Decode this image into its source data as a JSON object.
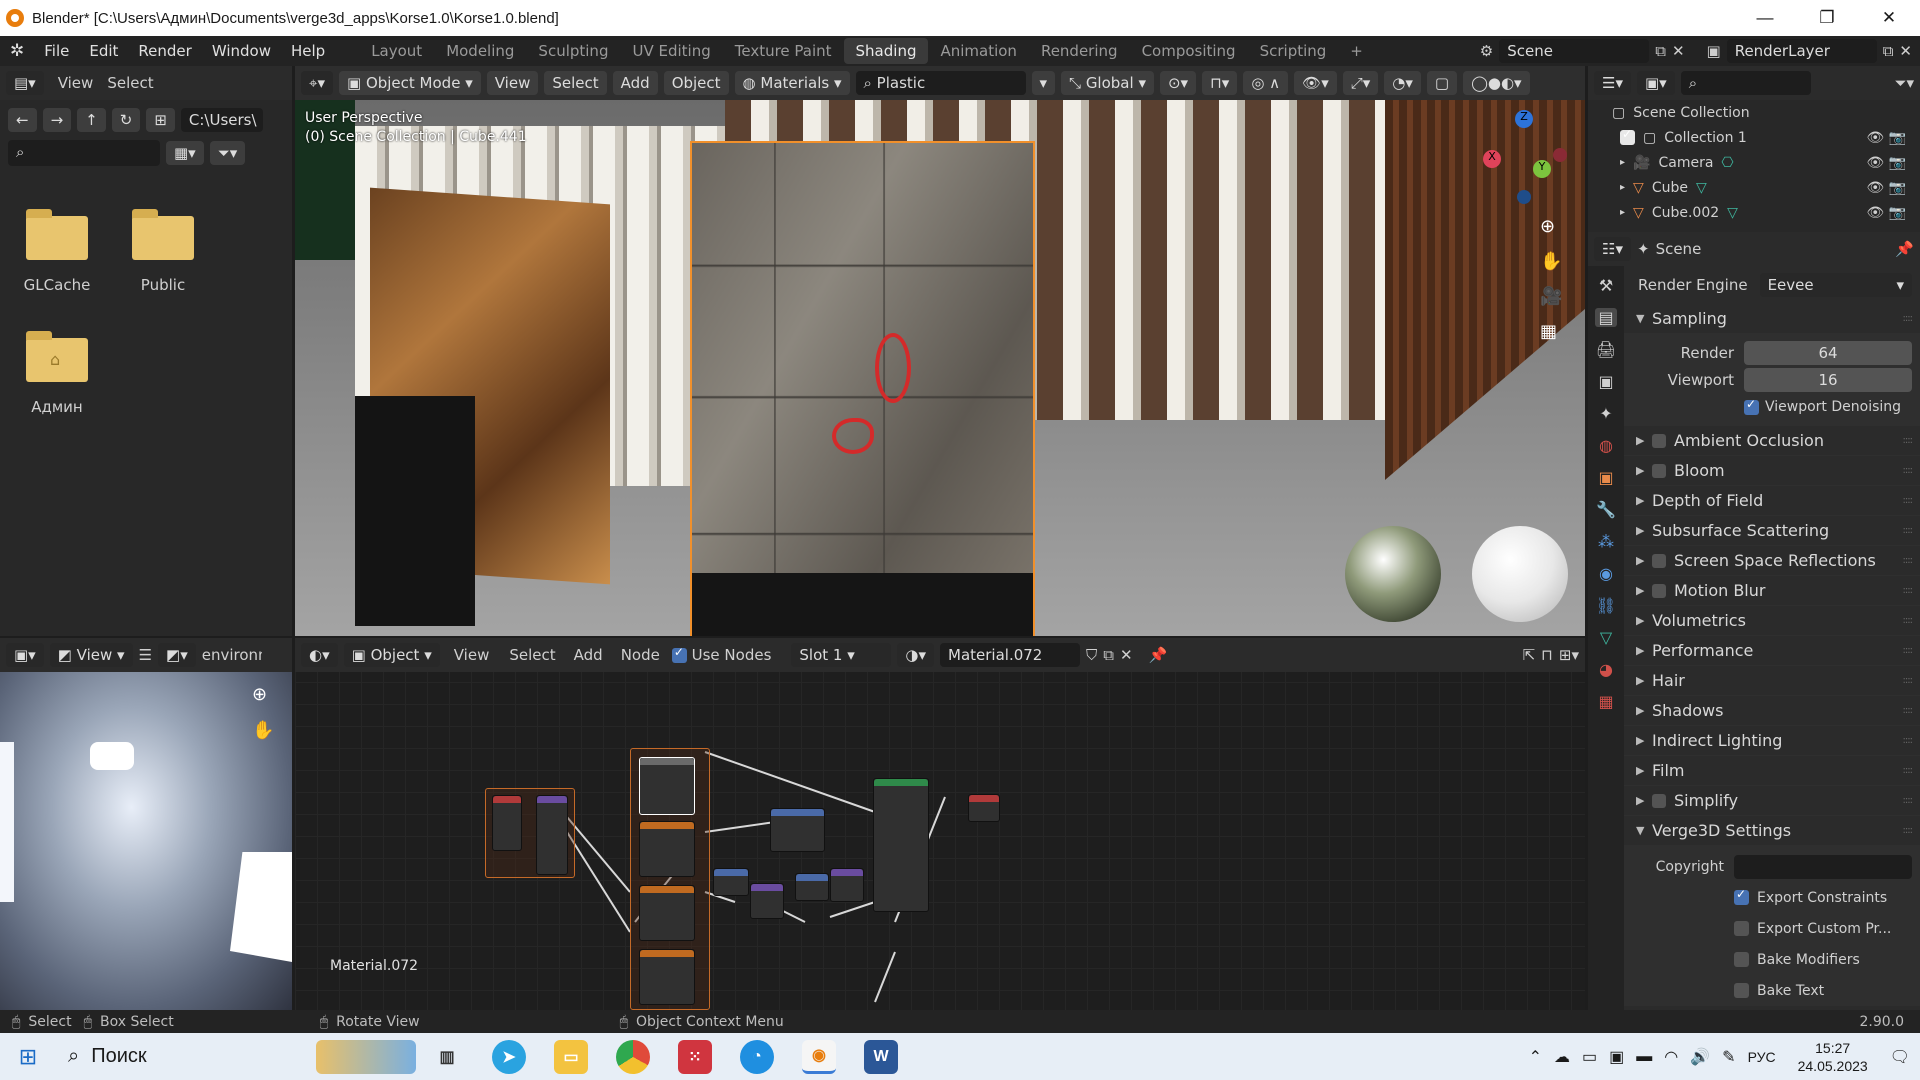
{
  "window": {
    "title": "Blender* [C:\\Users\\Админ\\Documents\\verge3d_apps\\Korse1.0\\Korse1.0.blend]",
    "minimize": "—",
    "maximize": "❐",
    "close": "✕"
  },
  "menu": [
    "File",
    "Edit",
    "Render",
    "Window",
    "Help"
  ],
  "workspaces": [
    "Layout",
    "Modeling",
    "Sculpting",
    "UV Editing",
    "Texture Paint",
    "Shading",
    "Animation",
    "Rendering",
    "Compositing",
    "Scripting"
  ],
  "active_workspace": "Shading",
  "scene": {
    "name": "Scene",
    "layer": "RenderLayer"
  },
  "filebrowser": {
    "menu": [
      "View",
      "Select"
    ],
    "path": "C:\\Users\\",
    "items": [
      {
        "name": "GLCache",
        "type": "folder"
      },
      {
        "name": "Public",
        "type": "folder"
      },
      {
        "name": "Админ",
        "type": "home-folder"
      }
    ]
  },
  "viewport": {
    "mode": "Object Mode",
    "menu": [
      "View",
      "Select",
      "Add",
      "Object"
    ],
    "materials_label": "Materials",
    "search_value": "Plastic",
    "orientation": "Global",
    "overlay_line1": "User Perspective",
    "overlay_line2": "(0) Scene Collection | Cube.441",
    "gizmo": {
      "x": "X",
      "y": "Y",
      "z": "Z"
    }
  },
  "imageeditor": {
    "view_label": "View",
    "image_name": "environm"
  },
  "nodeeditor": {
    "object_label": "Object",
    "menu": [
      "View",
      "Select",
      "Add",
      "Node"
    ],
    "use_nodes_label": "Use Nodes",
    "use_nodes_checked": true,
    "slot": "Slot 1",
    "material": "Material.072",
    "corner_label": "Material.072"
  },
  "outliner": {
    "root": "Scene Collection",
    "items": [
      {
        "name": "Collection 1",
        "icon": "collection-icon"
      },
      {
        "name": "Camera",
        "icon": "camera-icon"
      },
      {
        "name": "Cube",
        "icon": "mesh-icon"
      },
      {
        "name": "Cube.002",
        "icon": "mesh-icon"
      }
    ]
  },
  "properties": {
    "context": "Scene",
    "render_engine_label": "Render Engine",
    "render_engine": "Eevee",
    "sampling": {
      "label": "Sampling",
      "render_label": "Render",
      "render": "64",
      "viewport_label": "Viewport",
      "viewport": "16",
      "denoise_label": "Viewport Denoising",
      "denoise": true
    },
    "sections": [
      {
        "label": "Ambient Occlusion",
        "checkbox": true
      },
      {
        "label": "Bloom",
        "checkbox": true
      },
      {
        "label": "Depth of Field",
        "checkbox": false
      },
      {
        "label": "Subsurface Scattering",
        "checkbox": false
      },
      {
        "label": "Screen Space Reflections",
        "checkbox": true
      },
      {
        "label": "Motion Blur",
        "checkbox": true
      },
      {
        "label": "Volumetrics",
        "checkbox": false
      },
      {
        "label": "Performance",
        "checkbox": false
      },
      {
        "label": "Hair",
        "checkbox": false
      },
      {
        "label": "Shadows",
        "checkbox": false
      },
      {
        "label": "Indirect Lighting",
        "checkbox": false
      },
      {
        "label": "Film",
        "checkbox": false
      },
      {
        "label": "Simplify",
        "checkbox": true
      }
    ],
    "verge": {
      "label": "Verge3D Settings",
      "copyright_label": "Copyright",
      "copyright": "",
      "options": [
        {
          "label": "Export Constraints",
          "checked": true
        },
        {
          "label": "Export Custom Pr...",
          "checked": false
        },
        {
          "label": "Bake Modifiers",
          "checked": false
        },
        {
          "label": "Bake Text",
          "checked": false
        }
      ]
    }
  },
  "statusbar": {
    "select": "Select",
    "box_select": "Box Select",
    "rotate": "Rotate View",
    "context_menu": "Object Context Menu",
    "version": "2.90.0"
  },
  "taskbar": {
    "search": "Поиск",
    "lang": "РУС",
    "time": "15:27",
    "date": "24.05.2023"
  },
  "colors": {
    "accent": "#4772b3",
    "selection": "#f1902b",
    "blender_orange": "#e87d0d"
  }
}
